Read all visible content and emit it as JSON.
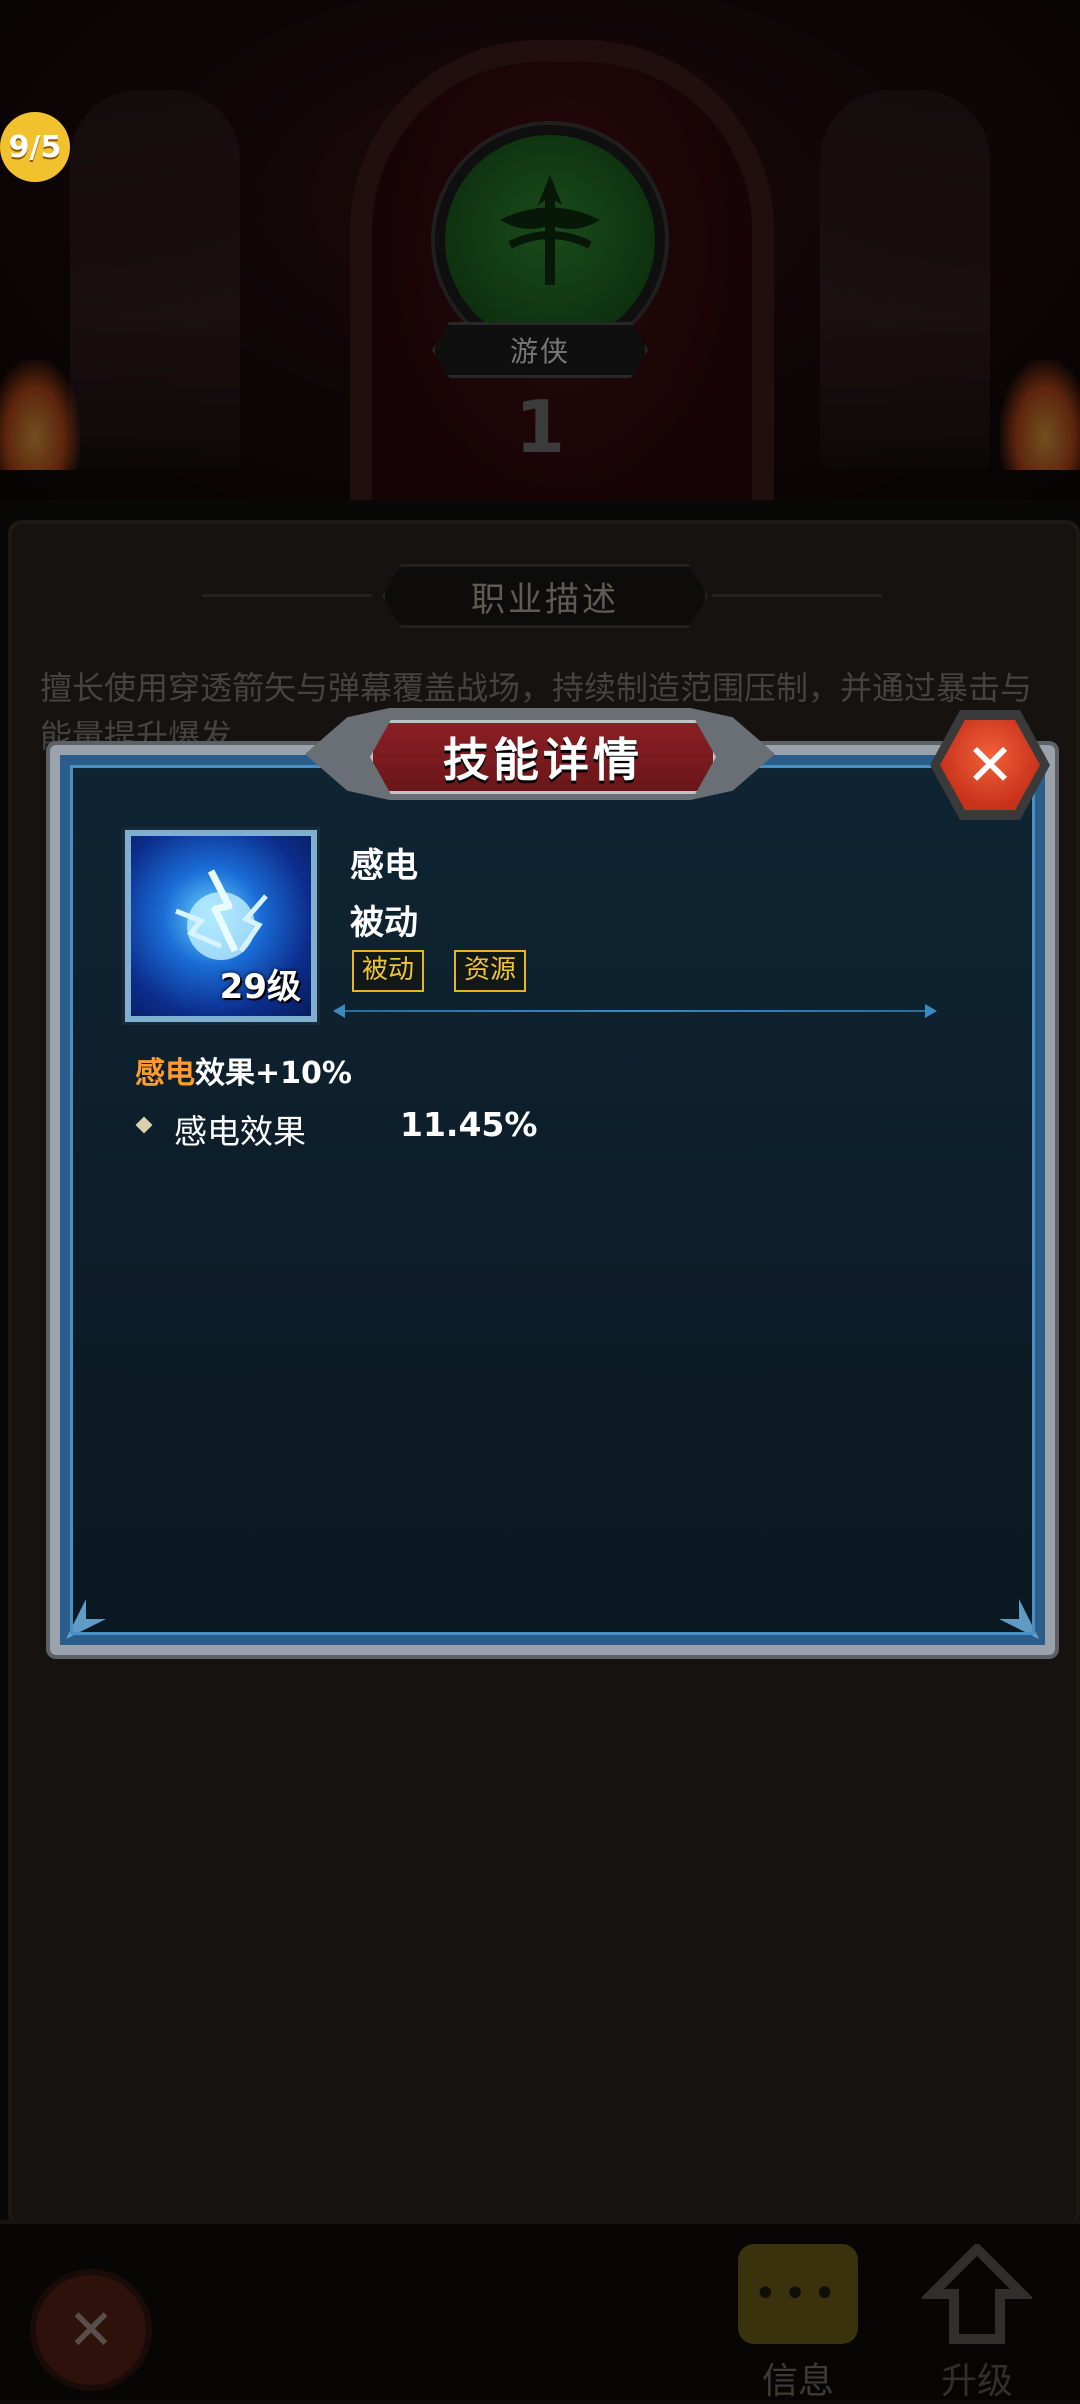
{
  "page_indicator": "9/5",
  "hero": {
    "class_name": "游侠",
    "class_level": "1"
  },
  "description": {
    "header": "职业描述",
    "text": "擅长使用穿透箭矢与弹幕覆盖战场，持续制造范围压制，并通过暴击与能量提升爆发"
  },
  "bottom_nav": {
    "info_label": "信息",
    "upgrade_label": "升级"
  },
  "skill_modal": {
    "title": "技能详情",
    "close_glyph": "✕",
    "skill": {
      "name": "感电",
      "type": "被动",
      "level_badge": "29级",
      "tags": [
        "被动",
        "资源"
      ],
      "effect_highlight": "感电",
      "effect_rest": "效果+10%",
      "stats": [
        {
          "label": "感电效果",
          "value": "11.45%"
        }
      ]
    }
  },
  "icons": {
    "class_emblem": "ranger-crest-icon",
    "skill": "lightning-orb-icon",
    "close": "close-icon",
    "info": "chat-bubble-icon",
    "upgrade": "upgrade-arrow-icon"
  },
  "colors": {
    "tag_gold": "#e6b520",
    "highlight_orange": "#ff9a2e",
    "modal_frame_blue": "#2a5d8a",
    "close_red": "#c7321a",
    "title_red": "#8a1f24"
  }
}
